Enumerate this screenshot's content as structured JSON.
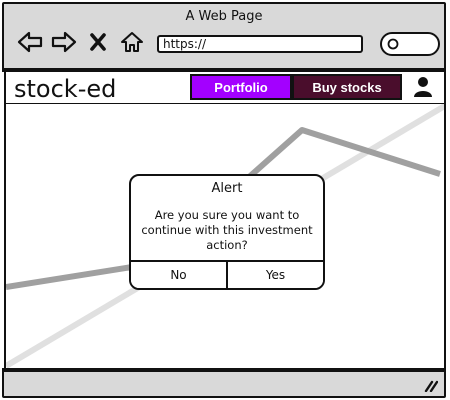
{
  "browser": {
    "title": "A Web Page",
    "url": "https://",
    "icons": [
      "back-arrow-icon",
      "forward-arrow-icon",
      "close-icon",
      "home-icon",
      "search-icon"
    ]
  },
  "app": {
    "logo": "stock-ed",
    "tabs": [
      {
        "label": "Portfolio",
        "color": "#a300ff",
        "active": true
      },
      {
        "label": "Buy stocks",
        "color": "#4a0d2c",
        "active": false
      }
    ],
    "user_icon": "user-icon"
  },
  "alert": {
    "title": "Alert",
    "message": "Are you sure you want to continue with this investment action?",
    "buttons": {
      "no": "No",
      "yes": "Yes"
    }
  },
  "colors": {
    "chrome": "#d9d9d9",
    "ink": "#111111",
    "chart_line_dark": "#a0a0a0",
    "chart_line_light": "#e0e0e0"
  }
}
